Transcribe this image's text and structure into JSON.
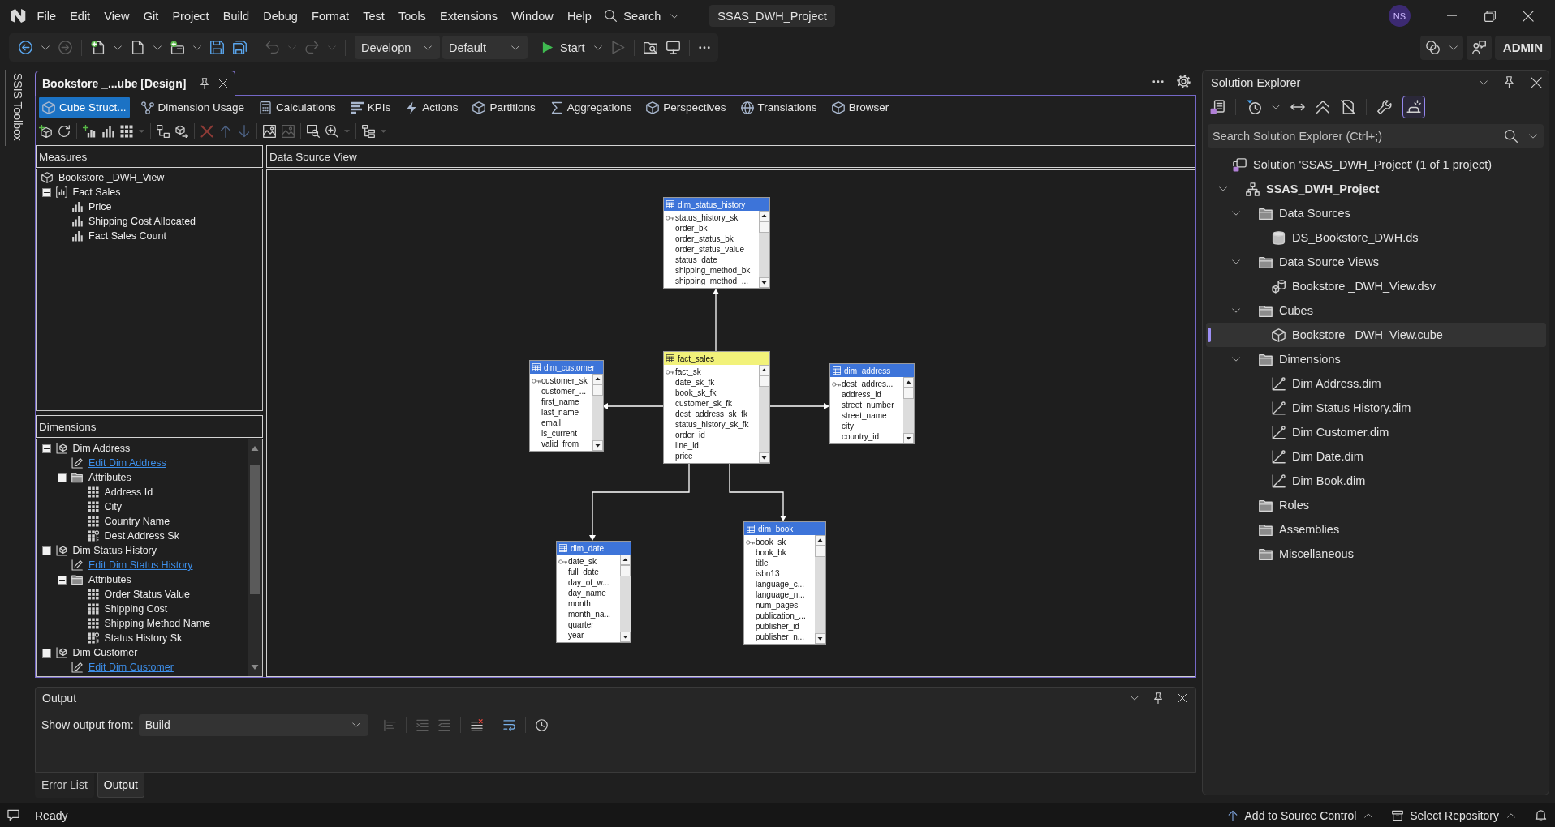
{
  "title_bar": {
    "menu": [
      "File",
      "Edit",
      "View",
      "Git",
      "Project",
      "Build",
      "Debug",
      "Format",
      "Test",
      "Tools",
      "Extensions",
      "Window",
      "Help"
    ],
    "search": "Search",
    "solution_name": "SSAS_DWH_Project",
    "account_initials": "NS"
  },
  "toolbar": {
    "groups": [
      [
        {
          "kind": "back",
          "disabled": false
        },
        {
          "kind": "dropdown",
          "disabled": false
        },
        {
          "kind": "forward",
          "disabled": true
        }
      ],
      [
        {
          "kind": "new_document",
          "disabled": false
        },
        {
          "kind": "dropdown",
          "disabled": false
        },
        {
          "kind": "document",
          "disabled": false
        },
        {
          "kind": "dropdown",
          "disabled": false
        },
        {
          "kind": "new_window",
          "disabled": false
        },
        {
          "kind": "dropdown",
          "disabled": false
        },
        {
          "kind": "save",
          "disabled": false
        },
        {
          "kind": "save_all",
          "disabled": false
        }
      ],
      [
        {
          "kind": "undo",
          "disabled": true
        },
        {
          "kind": "dropdown",
          "disabled": true
        },
        {
          "kind": "redo",
          "disabled": true
        },
        {
          "kind": "dropdown",
          "disabled": true
        }
      ]
    ],
    "configuration": "Developn",
    "platform": "Default",
    "start": "Start",
    "tools": [
      [
        {
          "kind": "play_outline",
          "disabled": true
        }
      ],
      [
        {
          "kind": "folder_search",
          "disabled": false
        },
        {
          "kind": "monitor",
          "disabled": false
        }
      ],
      [
        {
          "kind": "more",
          "disabled": false
        }
      ]
    ],
    "account": "ADMIN"
  },
  "toolbox": {
    "label": "SSIS Toolbox"
  },
  "document_tabs": [
    {
      "title": "Bookstore _...ube [Design]",
      "selected": true
    }
  ],
  "designer": {
    "tabs": [
      {
        "label": "Cube Struct...",
        "selected": true
      },
      {
        "label": "Dimension Usage",
        "selected": false
      },
      {
        "label": "Calculations",
        "selected": false
      },
      {
        "label": "KPIs",
        "selected": false
      },
      {
        "label": "Actions",
        "selected": false
      },
      {
        "label": "Partitions",
        "selected": false
      },
      {
        "label": "Aggregations",
        "selected": false
      },
      {
        "label": "Perspectives",
        "selected": false
      },
      {
        "label": "Translations",
        "selected": false
      },
      {
        "label": "Browser",
        "selected": false
      }
    ],
    "toolbar": [
      [
        {
          "kind": "cube_plus",
          "disabled": false
        },
        {
          "kind": "refresh",
          "disabled": false
        }
      ],
      [
        {
          "kind": "bar_chart_plus",
          "disabled": false
        },
        {
          "kind": "bar_chart",
          "disabled": false
        },
        {
          "kind": "grid",
          "disabled": false
        },
        {
          "kind": "caret",
          "disabled": true
        }
      ],
      [
        {
          "kind": "diagram",
          "disabled": false
        },
        {
          "kind": "cube_arrow",
          "disabled": false
        }
      ],
      [
        {
          "kind": "delete",
          "disabled": true
        },
        {
          "kind": "arrow_up",
          "disabled": true
        },
        {
          "kind": "arrow_down",
          "disabled": true
        }
      ],
      [
        {
          "kind": "picture",
          "disabled": false
        },
        {
          "kind": "picture",
          "disabled": true
        }
      ],
      [
        {
          "kind": "zoom_window",
          "disabled": false
        },
        {
          "kind": "zoom",
          "disabled": false
        },
        {
          "kind": "caret",
          "disabled": true
        }
      ],
      [
        {
          "kind": "tree_layout",
          "disabled": false
        },
        {
          "kind": "caret",
          "disabled": true
        }
      ]
    ]
  },
  "measures": {
    "title": "Measures",
    "tree": [
      {
        "label": "Bookstore _DWH_View",
        "kind": "cube",
        "selected": false,
        "children": [
          {
            "label": "Fact Sales",
            "kind": "measure_group",
            "expanded": true,
            "selected": false,
            "children": [
              {
                "label": "Price",
                "kind": "measure",
                "selected": false
              },
              {
                "label": "Shipping Cost Allocated",
                "kind": "measure",
                "selected": false
              },
              {
                "label": "Fact Sales Count",
                "kind": "measure",
                "selected": false
              }
            ]
          }
        ]
      }
    ]
  },
  "dimensions": {
    "title": "Dimensions",
    "tree": [
      {
        "label": "Dim Address",
        "kind": "dimension",
        "expanded": true,
        "selected": false,
        "children": [
          {
            "label": "Edit Dim Address",
            "kind": "link",
            "selected": false
          },
          {
            "label": "Attributes",
            "kind": "folder",
            "expanded": true,
            "selected": false,
            "children": [
              {
                "label": "Address Id",
                "kind": "attribute",
                "selected": false
              },
              {
                "label": "City",
                "kind": "attribute",
                "selected": false
              },
              {
                "label": "Country Name",
                "kind": "attribute",
                "selected": false
              },
              {
                "label": "Dest Address Sk",
                "kind": "key_attribute",
                "selected": false
              }
            ]
          }
        ]
      },
      {
        "label": "Dim Status History",
        "kind": "dimension",
        "expanded": true,
        "selected": false,
        "children": [
          {
            "label": "Edit Dim Status History",
            "kind": "link",
            "selected": false
          },
          {
            "label": "Attributes",
            "kind": "folder",
            "expanded": true,
            "selected": false,
            "children": [
              {
                "label": "Order Status Value",
                "kind": "attribute",
                "selected": false
              },
              {
                "label": "Shipping Cost",
                "kind": "attribute",
                "selected": false
              },
              {
                "label": "Shipping Method Name",
                "kind": "attribute",
                "selected": false
              },
              {
                "label": "Status History Sk",
                "kind": "key_attribute",
                "selected": false
              }
            ]
          }
        ]
      },
      {
        "label": "Dim Customer",
        "kind": "dimension",
        "expanded": true,
        "selected": false,
        "children": [
          {
            "label": "Edit Dim Customer",
            "kind": "link",
            "selected": false
          }
        ]
      }
    ]
  },
  "data_source_view": {
    "title": "Data Source View",
    "tables": [
      {
        "name": "dim_status_history",
        "kind": "dimension",
        "columns": [
          {
            "name": "status_history_sk",
            "key": true
          },
          {
            "name": "order_bk",
            "key": false
          },
          {
            "name": "order_status_bk",
            "key": false
          },
          {
            "name": "order_status_value",
            "key": false
          },
          {
            "name": "status_date",
            "key": false
          },
          {
            "name": "shipping_method_bk",
            "key": false
          },
          {
            "name": "shipping_method_...",
            "key": false
          }
        ]
      },
      {
        "name": "dim_customer",
        "kind": "dimension",
        "columns": [
          {
            "name": "customer_sk",
            "key": true
          },
          {
            "name": "customer_...",
            "key": false
          },
          {
            "name": "first_name",
            "key": false
          },
          {
            "name": "last_name",
            "key": false
          },
          {
            "name": "email",
            "key": false
          },
          {
            "name": "is_current",
            "key": false
          },
          {
            "name": "valid_from",
            "key": false
          }
        ]
      },
      {
        "name": "fact_sales",
        "kind": "fact",
        "columns": [
          {
            "name": "fact_sk",
            "key": true
          },
          {
            "name": "date_sk_fk",
            "key": false
          },
          {
            "name": "book_sk_fk",
            "key": false
          },
          {
            "name": "customer_sk_fk",
            "key": false
          },
          {
            "name": "dest_address_sk_fk",
            "key": false
          },
          {
            "name": "status_history_sk_fk",
            "key": false
          },
          {
            "name": "order_id",
            "key": false
          },
          {
            "name": "line_id",
            "key": false
          },
          {
            "name": "price",
            "key": false
          }
        ]
      },
      {
        "name": "dim_address",
        "kind": "dimension",
        "columns": [
          {
            "name": "dest_addres...",
            "key": true
          },
          {
            "name": "address_id",
            "key": false
          },
          {
            "name": "street_number",
            "key": false
          },
          {
            "name": "street_name",
            "key": false
          },
          {
            "name": "city",
            "key": false
          },
          {
            "name": "country_id",
            "key": false
          }
        ]
      },
      {
        "name": "dim_date",
        "kind": "dimension",
        "columns": [
          {
            "name": "date_sk",
            "key": true
          },
          {
            "name": "full_date",
            "key": false
          },
          {
            "name": "day_of_w...",
            "key": false
          },
          {
            "name": "day_name",
            "key": false
          },
          {
            "name": "month",
            "key": false
          },
          {
            "name": "month_na...",
            "key": false
          },
          {
            "name": "quarter",
            "key": false
          },
          {
            "name": "year",
            "key": false
          }
        ]
      },
      {
        "name": "dim_book",
        "kind": "dimension",
        "columns": [
          {
            "name": "book_sk",
            "key": true
          },
          {
            "name": "book_bk",
            "key": false
          },
          {
            "name": "title",
            "key": false
          },
          {
            "name": "isbn13",
            "key": false
          },
          {
            "name": "language_c...",
            "key": false
          },
          {
            "name": "language_n...",
            "key": false
          },
          {
            "name": "num_pages",
            "key": false
          },
          {
            "name": "publication_...",
            "key": false
          },
          {
            "name": "publisher_id",
            "key": false
          },
          {
            "name": "publisher_n...",
            "key": false
          }
        ]
      }
    ]
  },
  "output": {
    "title": "Output",
    "source_label": "Show output from:",
    "source": "Build",
    "toolbar": [
      [
        {
          "kind": "align_left",
          "disabled": true
        }
      ],
      [
        {
          "kind": "outdent",
          "disabled": true
        },
        {
          "kind": "indent",
          "disabled": true
        }
      ],
      [
        {
          "kind": "clear_list",
          "disabled": false
        }
      ],
      [
        {
          "kind": "word_wrap",
          "disabled": false
        }
      ],
      [
        {
          "kind": "clock",
          "disabled": false
        }
      ]
    ],
    "tabs": [
      {
        "label": "Error List",
        "selected": false
      },
      {
        "label": "Output",
        "selected": true
      }
    ]
  },
  "solution_explorer": {
    "title": "Solution Explorer",
    "toolbar": [
      [
        {
          "kind": "switch_views",
          "on": false
        }
      ],
      [
        {
          "kind": "pending_filter",
          "on": false
        },
        {
          "kind": "dropdown",
          "on": false
        },
        {
          "kind": "sync",
          "on": false
        },
        {
          "kind": "collapse_all",
          "on": false
        },
        {
          "kind": "show_all_files",
          "on": false
        }
      ],
      [
        {
          "kind": "properties",
          "on": false
        },
        {
          "kind": "preview",
          "on": true
        }
      ]
    ],
    "search": {
      "placeholder": "Search Solution Explorer (Ctrl+;)"
    },
    "tree": [
      {
        "label": "Solution 'SSAS_DWH_Project' (1 of 1 project)",
        "kind": "solution",
        "selected": false,
        "children": [
          {
            "label": "SSAS_DWH_Project",
            "kind": "project",
            "expanded": true,
            "selected": false,
            "children": [
              {
                "label": "Data Sources",
                "kind": "folder",
                "expanded": true,
                "selected": false,
                "children": [
                  {
                    "label": "DS_Bookstore_DWH.ds",
                    "kind": "data_source",
                    "selected": false
                  }
                ]
              },
              {
                "label": "Data Source Views",
                "kind": "folder",
                "expanded": true,
                "selected": false,
                "children": [
                  {
                    "label": "Bookstore _DWH_View.dsv",
                    "kind": "data_source_view",
                    "selected": false
                  }
                ]
              },
              {
                "label": "Cubes",
                "kind": "folder",
                "expanded": true,
                "selected": false,
                "children": [
                  {
                    "label": "Bookstore _DWH_View.cube",
                    "kind": "cube",
                    "selected": true
                  }
                ]
              },
              {
                "label": "Dimensions",
                "kind": "folder",
                "expanded": true,
                "selected": false,
                "children": [
                  {
                    "label": "Dim Address.dim",
                    "kind": "dimension",
                    "selected": false
                  },
                  {
                    "label": "Dim Status History.dim",
                    "kind": "dimension",
                    "selected": false
                  },
                  {
                    "label": "Dim Customer.dim",
                    "kind": "dimension",
                    "selected": false
                  },
                  {
                    "label": "Dim Date.dim",
                    "kind": "dimension",
                    "selected": false
                  },
                  {
                    "label": "Dim Book.dim",
                    "kind": "dimension",
                    "selected": false
                  }
                ]
              },
              {
                "label": "Roles",
                "kind": "folder",
                "selected": false
              },
              {
                "label": "Assemblies",
                "kind": "folder",
                "selected": false
              },
              {
                "label": "Miscellaneous",
                "kind": "folder",
                "selected": false
              }
            ]
          }
        ]
      }
    ]
  },
  "status_bar": {
    "state": "Ready",
    "source_control": "Add to Source Control",
    "repository": "Select Repository"
  }
}
